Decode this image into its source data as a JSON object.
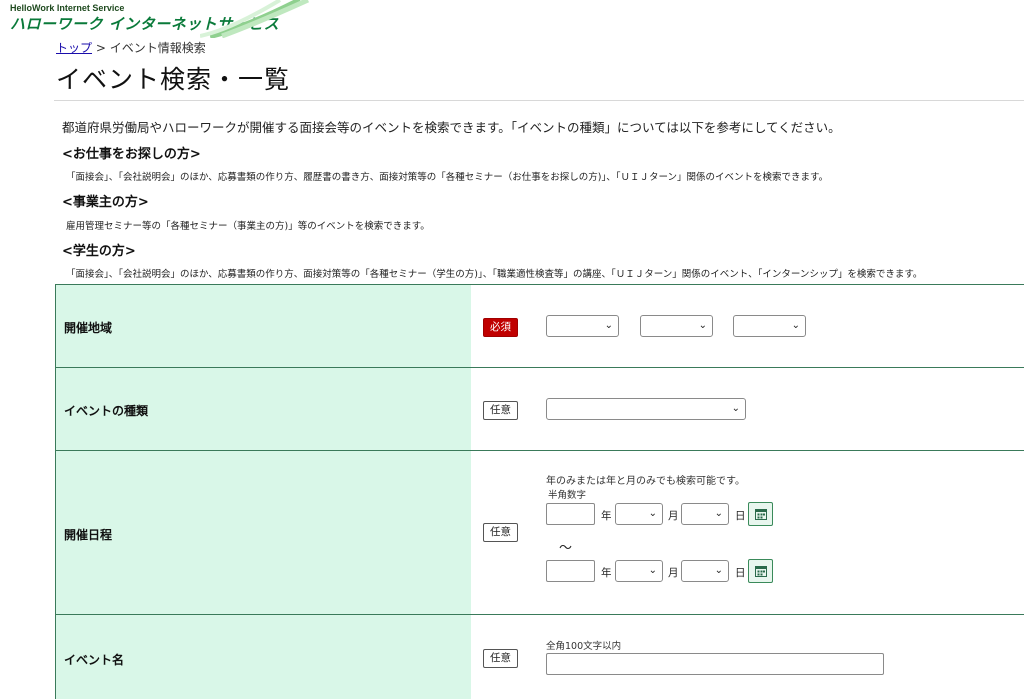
{
  "header": {
    "logo_en": "HelloWork Internet Service",
    "logo_jp": "ハローワーク インターネットサービス"
  },
  "breadcrumb": {
    "top_link": "トップ",
    "separator": ">",
    "current": "イベント情報検索"
  },
  "page_title": "イベント検索・一覧",
  "intro": "都道府県労働局やハローワークが開催する面接会等のイベントを検索できます。「イベントの種類」については以下を参考にしてください。",
  "sections": [
    {
      "heading": "<お仕事をお探しの方>",
      "text": "「面接会」、「会社説明会」のほか、応募書類の作り方、履歴書の書き方、面接対策等の「各種セミナー（お仕事をお探しの方)」、「ＵＩＪターン」関係のイベントを検索できます。"
    },
    {
      "heading": "<事業主の方>",
      "text": "雇用管理セミナー等の「各種セミナー（事業主の方)」等のイベントを検索できます。"
    },
    {
      "heading": "<学生の方>",
      "text": "「面接会」、「会社説明会」のほか、応募書類の作り方、面接対策等の「各種セミナー（学生の方)」、「職業適性検査等」の講座、「ＵＩＪターン」関係のイベント、「インターンシップ」を検索できます。"
    }
  ],
  "form": {
    "area": {
      "label": "開催地域",
      "badge": "必須",
      "select1": "",
      "select2": "",
      "select3": ""
    },
    "type": {
      "label": "イベントの種類",
      "badge": "任意",
      "select": ""
    },
    "date": {
      "label": "開催日程",
      "badge": "任意",
      "note": "年のみまたは年と月のみでも検索可能です。",
      "hint": "半角数字",
      "year_unit": "年",
      "month_unit": "月",
      "day_unit": "日",
      "range_sep": "～",
      "from_year": "",
      "to_year": ""
    },
    "name": {
      "label": "イベント名",
      "badge": "任意",
      "hint": "全角100文字以内",
      "value": ""
    }
  },
  "colors": {
    "label_bg": "#d9f7e8",
    "border": "#3a7a5a",
    "required": "#c00000",
    "brand": "#0a7a3a"
  }
}
